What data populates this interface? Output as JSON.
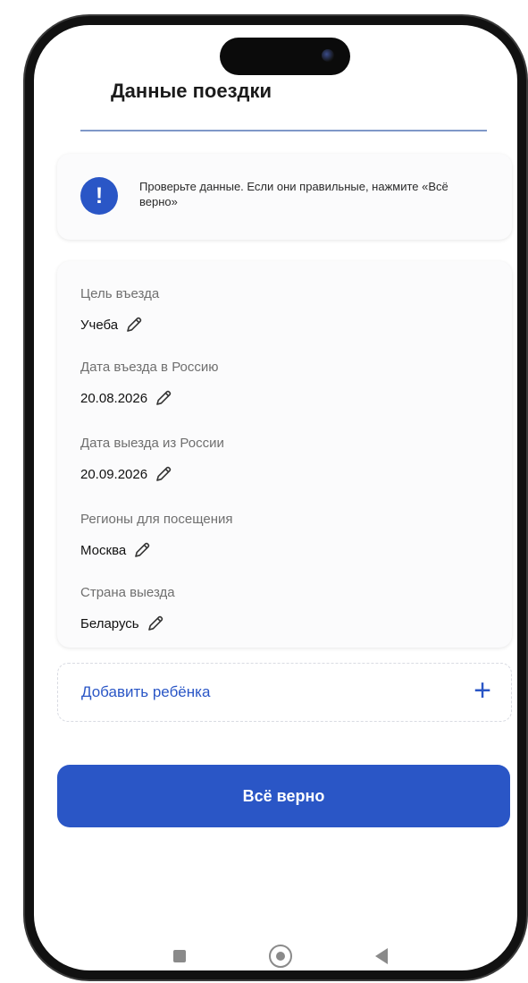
{
  "header": {
    "title": "Данные поездки"
  },
  "notice": {
    "icon": "exclamation-icon",
    "text": "Проверьте данные. Если они правильные, нажмите «Всё верно»"
  },
  "details": {
    "fields": [
      {
        "label": "Цель въезда",
        "value": "Учеба"
      },
      {
        "label": "Дата въезда в Россию",
        "value": "20.08.2026"
      },
      {
        "label": "Дата выезда из России",
        "value": "20.09.2026"
      },
      {
        "label": "Регионы для посещения",
        "value": "Москва"
      },
      {
        "label": "Страна выезда",
        "value": "Беларусь"
      }
    ],
    "edit_icon": "pencil-icon"
  },
  "add_child": {
    "label": "Добавить ребёнка",
    "icon": "plus-icon"
  },
  "confirm_button": {
    "label": "Всё верно"
  },
  "nav": {
    "recents_icon": "square-icon",
    "home_icon": "circle-home-icon",
    "back_icon": "triangle-back-icon"
  },
  "colors": {
    "accent": "#2a56c6",
    "divider": "#7f98c8",
    "card_bg": "#fbfbfc"
  }
}
